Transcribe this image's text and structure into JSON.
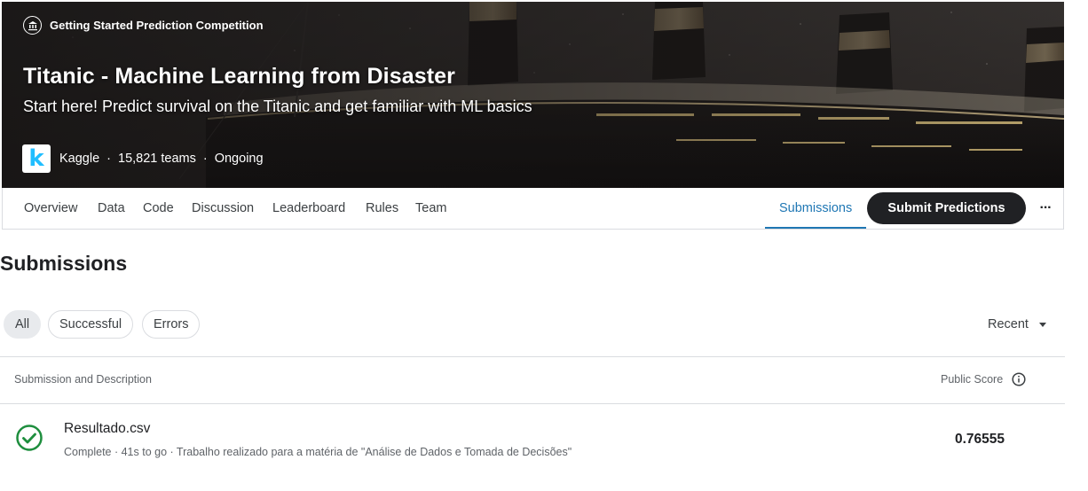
{
  "hero": {
    "competition_type": "Getting Started Prediction Competition",
    "title": "Titanic - Machine Learning from Disaster",
    "subtitle": "Start here! Predict survival on the Titanic and get familiar with ML basics",
    "host_logo_letter": "k",
    "host": "Kaggle",
    "teams": "15,821 teams",
    "status": "Ongoing",
    "separator": "·"
  },
  "tabs": {
    "items": [
      "Overview",
      "Data",
      "Code",
      "Discussion",
      "Leaderboard",
      "Rules",
      "Team"
    ],
    "active": "Submissions",
    "submit_label": "Submit Predictions",
    "more_label": "···"
  },
  "page": {
    "title": "Submissions"
  },
  "filters": {
    "chips": [
      "All",
      "Successful",
      "Errors"
    ],
    "selected": "All",
    "sort_label": "Recent"
  },
  "table": {
    "col_submission": "Submission and Description",
    "col_score": "Public Score",
    "rows": [
      {
        "name": "Resultado.csv",
        "meta": "Complete · 41s to go · Trabalho realizado para a matéria de \"Análise de Dados e Tomada de Decisões\"",
        "score": "0.76555",
        "status_icon": "check-circle-icon"
      }
    ]
  },
  "colors": {
    "accent_tab": "#1f77b4",
    "success": "#1e8e3e",
    "button_dark": "#202124",
    "kaggle_blue": "#20beff"
  }
}
